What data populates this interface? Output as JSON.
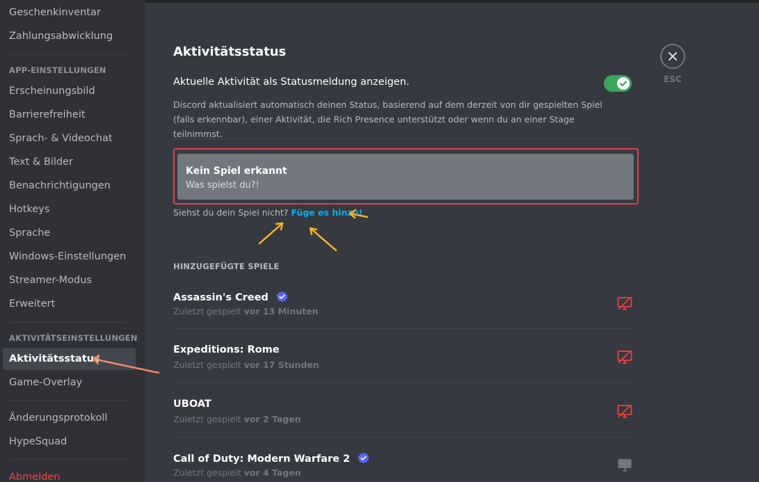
{
  "sidebar": {
    "items_top": [
      {
        "label": "Geschenkinventar"
      },
      {
        "label": "Zahlungsabwicklung"
      }
    ],
    "app_header": "APP-EINSTELLUNGEN",
    "app_items": [
      {
        "label": "Erscheinungsbild"
      },
      {
        "label": "Barrierefreiheit"
      },
      {
        "label": "Sprach- & Videochat"
      },
      {
        "label": "Text & Bilder"
      },
      {
        "label": "Benachrichtigungen"
      },
      {
        "label": "Hotkeys"
      },
      {
        "label": "Sprache"
      },
      {
        "label": "Windows-Einstellungen"
      },
      {
        "label": "Streamer-Modus"
      },
      {
        "label": "Erweitert"
      }
    ],
    "activity_header": "AKTIVITÄTSEINSTELLUNGEN",
    "activity_items": [
      {
        "label": "Aktivitätsstatus",
        "active": true
      },
      {
        "label": "Game-Overlay"
      }
    ],
    "misc_items": [
      {
        "label": "Änderungsprotokoll"
      },
      {
        "label": "HypeSquad"
      }
    ],
    "logout": "Abmelden"
  },
  "main": {
    "title": "Aktivitätsstatus",
    "toggle_label": "Aktuelle Aktivität als Statusmeldung anzeigen.",
    "toggle_on": true,
    "description": "Discord aktualisiert automatisch deinen Status, basierend auf dem derzeit von dir gespielten Spiel (falls erkennbar), einer Aktivität, die Rich Presence unterstützt oder wenn du an einer Stage teilnimmst.",
    "detect_title": "Kein Spiel erkannt",
    "detect_sub": "Was spielst du?!",
    "add_prefix": "Siehst du dein Spiel nicht?",
    "add_link": "Füge es hinzu!",
    "added_header": "HINZUGEFÜGTE SPIELE",
    "games": [
      {
        "name": "Assassin's Creed",
        "verified": true,
        "last_prefix": "Zuletzt gespielt",
        "last_value": "vor 13 Minuten",
        "overlay_icon": "monitor-off-icon"
      },
      {
        "name": "Expeditions: Rome",
        "verified": false,
        "last_prefix": "Zuletzt gespielt",
        "last_value": "vor 17 Stunden",
        "overlay_icon": "monitor-off-icon"
      },
      {
        "name": "UBOAT",
        "verified": false,
        "last_prefix": "Zuletzt gespielt",
        "last_value": "vor 2 Tagen",
        "overlay_icon": "monitor-off-icon"
      },
      {
        "name": "Call of Duty: Modern Warfare 2",
        "verified": true,
        "last_prefix": "Zuletzt gespielt",
        "last_value": "vor 4 Tagen",
        "overlay_icon": "monitor-icon"
      }
    ]
  },
  "esc": {
    "label": "ESC"
  },
  "colors": {
    "accent_link": "#00aff4",
    "toggle_on": "#3ba55d",
    "danger": "#ed4245",
    "verified": "#5865f2",
    "annotation_arrow": "#f0b429",
    "annotation_box": "#e0414d"
  }
}
